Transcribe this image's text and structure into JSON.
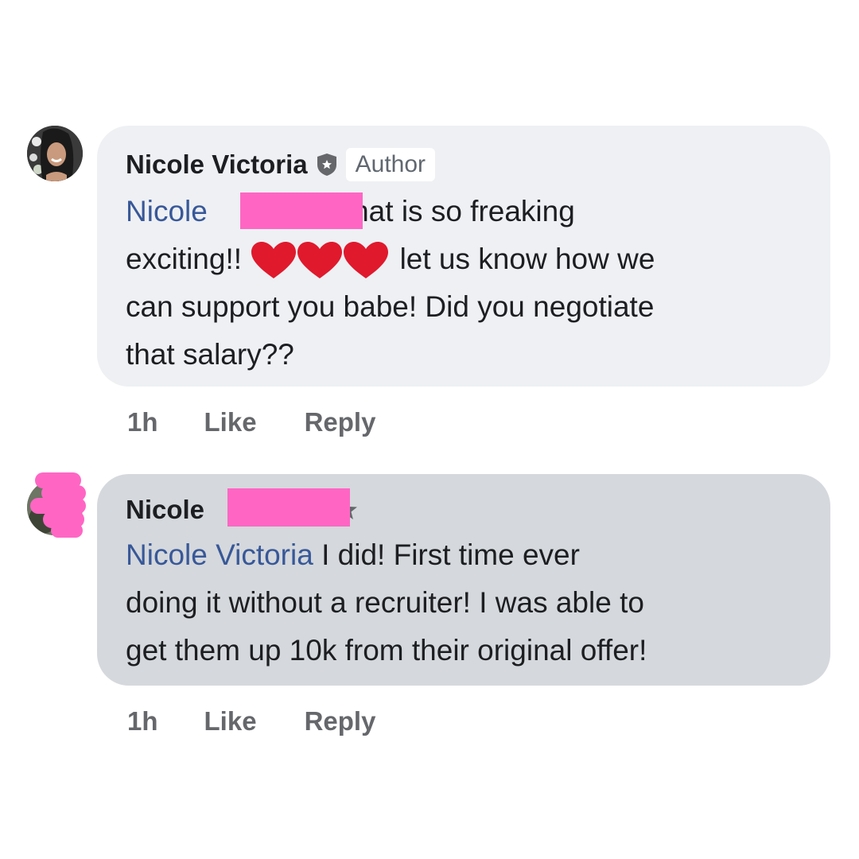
{
  "comments": [
    {
      "author": "Nicole Victoria",
      "badge": "Author",
      "mention": "Nicole",
      "line1_after": "that is so freaking",
      "line2_before": "exciting!!",
      "line2_after": "let us know how we",
      "line3": "can support you babe! Did you negotiate",
      "line4": "that salary??",
      "time": "1h",
      "like_label": "Like",
      "reply_label": "Reply"
    },
    {
      "author": "Nicole",
      "mention": "Nicole Victoria",
      "line1_after": "I did! First time ever",
      "line2": "doing it without a recruiter! I was able to",
      "line3": "get them up 10k from their original offer!",
      "time": "1h",
      "like_label": "Like",
      "reply_label": "Reply"
    }
  ],
  "icons": {
    "author_shield": "shield-icon",
    "hearts": "red-heart-icon",
    "fan_star": "star-icon"
  },
  "colors": {
    "mention": "#385898",
    "redaction": "#ff66c4",
    "bubble_author": "#eef0f3",
    "bubble_reply": "#d5d8dc"
  }
}
